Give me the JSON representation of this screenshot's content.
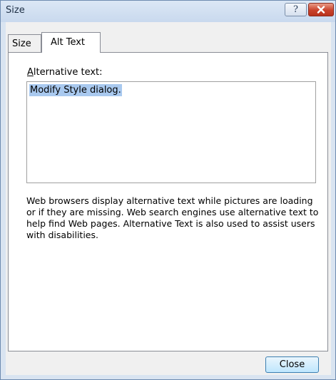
{
  "window": {
    "title": "Size",
    "help_glyph": "?",
    "close_icon": "close-x-icon"
  },
  "tabs": [
    {
      "label": "Size",
      "selected": false
    },
    {
      "label": "Alt Text",
      "selected": true
    }
  ],
  "alt_text": {
    "label_accel": "A",
    "label_rest": "lternative text:",
    "value": "Modify Style dialog.",
    "help": "Web browsers display alternative text while pictures are loading\nor if they are missing.  Web search engines use alternative text to\nhelp find Web pages.  Alternative Text is also used to assist users\nwith disabilities."
  },
  "buttons": {
    "close_label": "Close"
  },
  "colors": {
    "selection": "#a9c9ef",
    "close_x": "#c9422b"
  }
}
